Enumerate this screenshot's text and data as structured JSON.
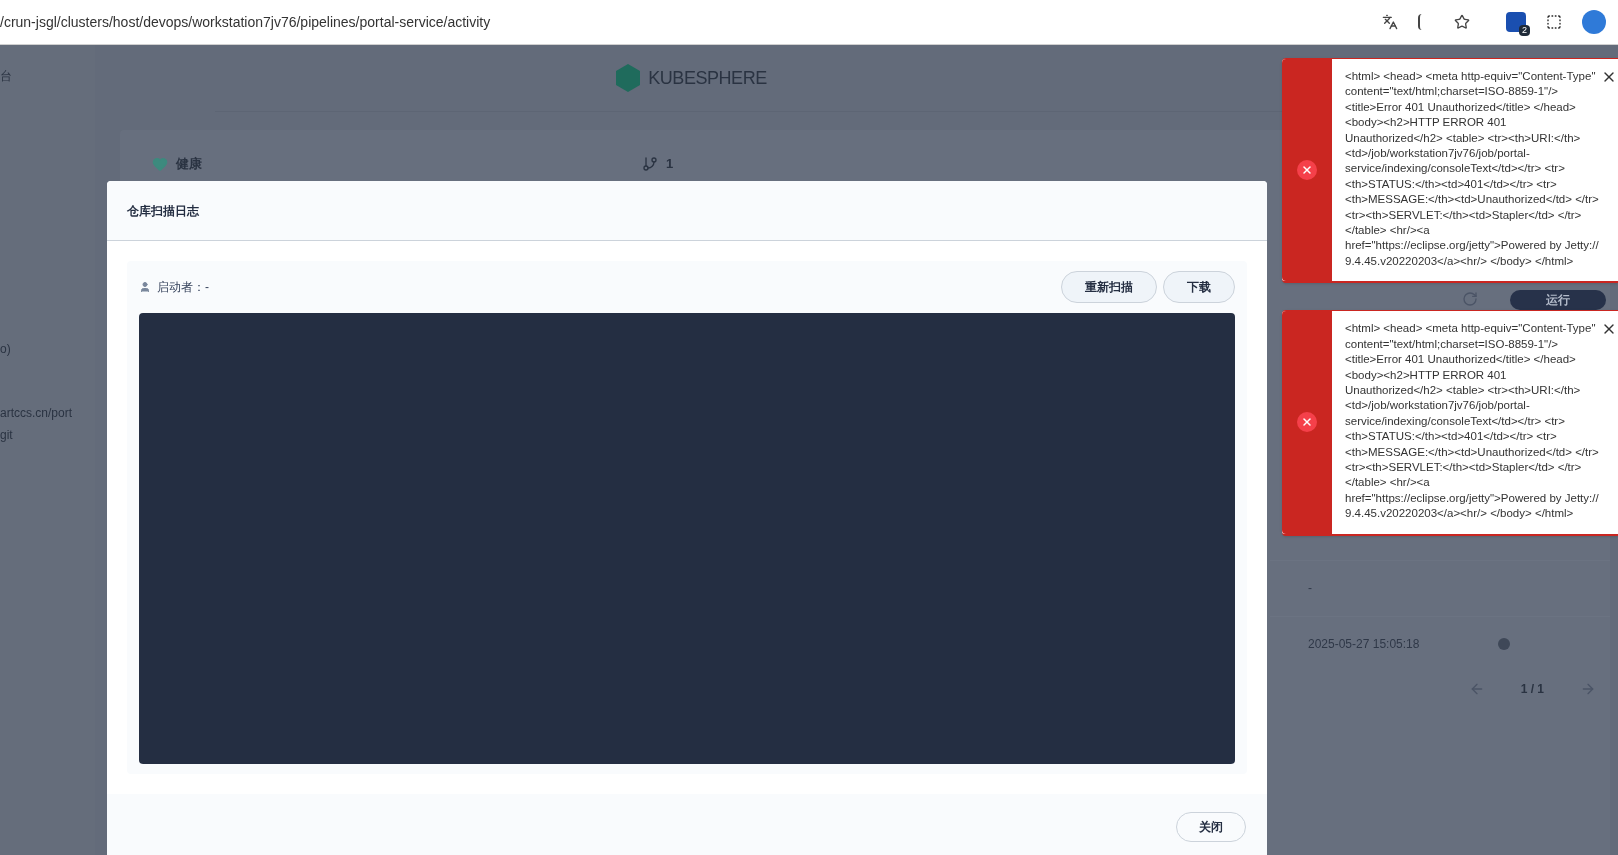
{
  "browser": {
    "url": "/crun-jsgl/clusters/host/devops/workstation7jv76/pipelines/portal-service/activity",
    "extension_badge": "2"
  },
  "background": {
    "sidebar_texts": [
      "台",
      "o)",
      "artccs.cn/port",
      "git"
    ],
    "logo": "KUBESPHERE",
    "stats": [
      {
        "kind": "health",
        "value": "健康"
      },
      {
        "kind": "branch",
        "value": "1"
      }
    ],
    "run_button": "运行",
    "rows": [
      {
        "text": "-"
      },
      {
        "text": "2025-05-27 15:05:18"
      }
    ],
    "pagination": "1 / 1"
  },
  "dialog": {
    "title": "仓库扫描日志",
    "starter_label": "启动者：-",
    "buttons": [
      "重新扫描",
      "下载"
    ],
    "close_button": "关闭"
  },
  "notifications": [
    {
      "kind": "error",
      "message": "<html> <head> <meta http-equiv=\"Content-Type\" content=\"text/html;charset=ISO-8859-1\"/> <title>Error 401 Unauthorized</title> </head> <body><h2>HTTP ERROR 401 Unauthorized</h2> <table> <tr><th>URI:</th> <td>/job/workstation7jv76/job/portal-service/indexing/consoleText</td></tr> <tr> <th>STATUS:</th><td>401</td></tr> <tr> <th>MESSAGE:</th><td>Unauthorized</td> </tr> <tr><th>SERVLET:</th><td>Stapler</td> </tr> </table> <hr/><a href=\"https://eclipse.org/jetty\">Powered by Jetty:// 9.4.45.v20220203</a><hr/> </body> </html>"
    },
    {
      "kind": "error",
      "message": "<html> <head> <meta http-equiv=\"Content-Type\" content=\"text/html;charset=ISO-8859-1\"/> <title>Error 401 Unauthorized</title> </head> <body><h2>HTTP ERROR 401 Unauthorized</h2> <table> <tr><th>URI:</th> <td>/job/workstation7jv76/job/portal-service/indexing/consoleText</td></tr> <tr> <th>STATUS:</th><td>401</td></tr> <tr> <th>MESSAGE:</th><td>Unauthorized</td> </tr> <tr><th>SERVLET:</th><td>Stapler</td> </tr> </table> <hr/><a href=\"https://eclipse.org/jetty\">Powered by Jetty:// 9.4.45.v20220203</a><hr/> </body> </html>"
    }
  ]
}
